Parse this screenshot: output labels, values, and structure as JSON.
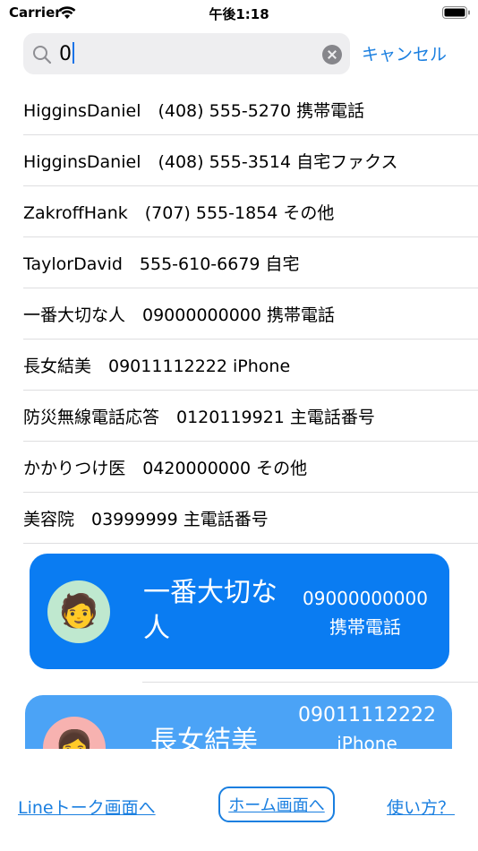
{
  "status_bar": {
    "carrier": "Carrier",
    "time": "午後1:18"
  },
  "search": {
    "value": "0",
    "cancel_label": "キャンセル"
  },
  "contacts": [
    "HigginsDaniel　(408) 555-5270 携帯電話",
    "HigginsDaniel　(408) 555-3514 自宅ファクス",
    "ZakroffHank　(707) 555-1854 その他",
    "TaylorDavid　555-610-6679 自宅",
    "一番大切な人　09000000000 携帯電話",
    "長女結美　09011112222 iPhone",
    "防災無線電話応答　0120119921 主電話番号",
    "かかりつけ医　0420000000 その他",
    "美容院　03999999 主電話番号"
  ],
  "cards": [
    {
      "name": "一番大切な人",
      "number": "09000000000",
      "label": "携帯電話",
      "avatar": "🧑"
    },
    {
      "name": "長女結美",
      "number": "09011112222",
      "label": "iPhone",
      "avatar": "👩"
    }
  ],
  "footer": {
    "line_talk": "Lineトーク画面へ",
    "home": "ホーム画面へ",
    "how_to": "使い方？"
  },
  "colors": {
    "accent": "#1a7fe0",
    "card_primary": "#0a7cf2",
    "card_secondary": "#4ba3f6"
  }
}
